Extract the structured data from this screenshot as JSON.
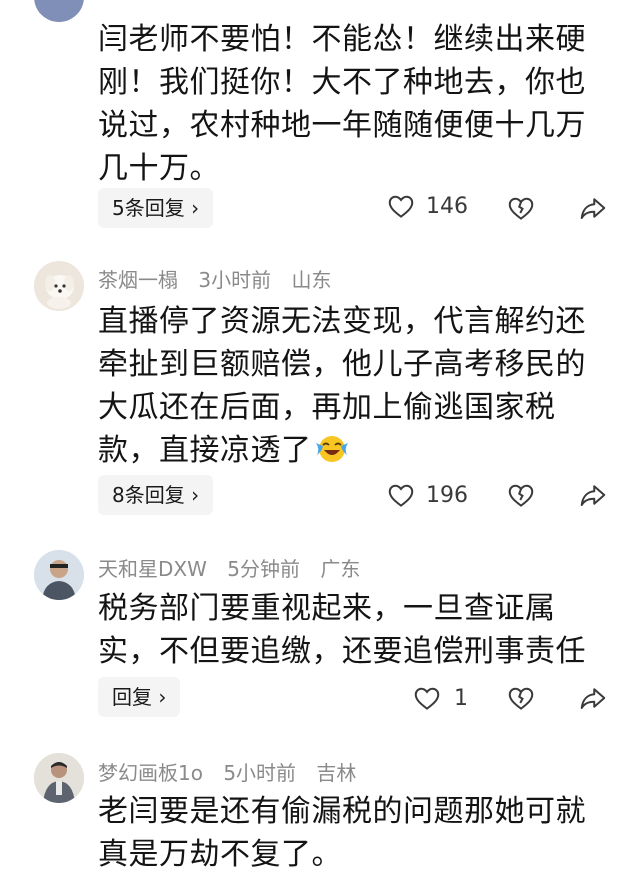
{
  "comments": [
    {
      "author": "",
      "time": "",
      "location": "",
      "text_lines": [
        "闫老师不要怕！不能怂！继续出来硬",
        "刚！我们挺你！大不了种地去，你也",
        "说过，农村种地一年随随便便十几万",
        "几十万。"
      ],
      "reply_label": "5条回复 ›",
      "likes": "146"
    },
    {
      "author": "茶烟一榻",
      "time": "3小时前",
      "location": "山东",
      "text_lines": [
        "直播停了资源无法变现，代言解约还",
        "牵扯到巨额赔偿，他儿子高考移民的",
        "大瓜还在后面，再加上偷逃国家税",
        "款，直接凉透了"
      ],
      "reply_label": "8条回复 ›",
      "likes": "196"
    },
    {
      "author": "天和星DXW",
      "time": "5分钟前",
      "location": "广东",
      "text_lines": [
        "税务部门要重视起来，一旦查证属",
        "实，不但要追缴，还要追偿刑事责任"
      ],
      "reply_label": "回复 ›",
      "likes": "1"
    },
    {
      "author": "梦幻画板1o",
      "time": "5小时前",
      "location": "吉林",
      "text_lines": [
        "老闫要是还有偷漏税的问题那她可就",
        "真是万劫不复了。"
      ],
      "reply_label": "",
      "likes": ""
    }
  ],
  "icons": [
    "heart-icon",
    "broken-heart-icon",
    "share-icon",
    "laughing-crying-emoji-icon"
  ]
}
